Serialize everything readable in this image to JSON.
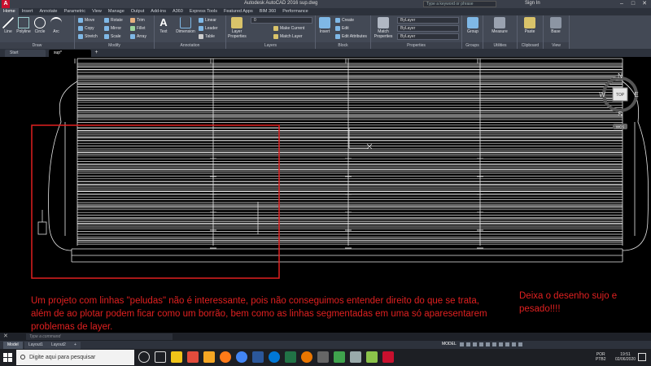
{
  "window": {
    "title": "Autodesk AutoCAD 2016    sup.dwg",
    "search_placeholder": "Type a keyword or phrase",
    "signin": "Sign In",
    "controls": [
      "–",
      "□",
      "✕"
    ]
  },
  "ribbon_tabs": [
    "Home",
    "Insert",
    "Annotate",
    "Parametric",
    "View",
    "Manage",
    "Output",
    "Add-ins",
    "A360",
    "Express Tools",
    "Featured Apps",
    "BIM 360",
    "Performance"
  ],
  "ribbon": {
    "draw": {
      "title": "Draw",
      "line": "Line",
      "polyline": "Polyline",
      "circle": "Circle",
      "arc": "Arc"
    },
    "modify": {
      "title": "Modify",
      "move": "Move",
      "rotate": "Rotate",
      "trim": "Trim",
      "copy": "Copy",
      "mirror": "Mirror",
      "fillet": "Fillet",
      "stretch": "Stretch",
      "scale": "Scale",
      "array": "Array"
    },
    "annotation": {
      "title": "Annotation",
      "text": "Text",
      "dimension": "Dimension",
      "linear": "Linear",
      "leader": "Leader",
      "table": "Table"
    },
    "layers": {
      "title": "Layers",
      "layer_properties": "Layer Properties",
      "current_layer": "0",
      "make_current": "Make Current",
      "match_layer": "Match Layer"
    },
    "block": {
      "title": "Block",
      "insert": "Insert",
      "create": "Create",
      "edit": "Edit",
      "edit_attributes": "Edit Attributes"
    },
    "properties": {
      "title": "Properties",
      "match_properties": "Match Properties",
      "bylayer1": "ByLayer",
      "bylayer2": "ByLayer",
      "bylayer3": "ByLayer"
    },
    "groups": {
      "title": "Groups",
      "group": "Group"
    },
    "utilities": {
      "title": "Utilities",
      "measure": "Measure"
    },
    "clipboard": {
      "title": "Clipboard",
      "paste": "Paste"
    },
    "view": {
      "title": "View",
      "base": "Base"
    }
  },
  "doc_tabs": [
    "Start",
    "sup*"
  ],
  "viewcube": {
    "n": "N",
    "s": "S",
    "e": "E",
    "w": "W",
    "top": "TOP",
    "wcs": "WCS"
  },
  "annotations": {
    "main": "Um projeto com linhas \"peludas\" não é interessante,  pois não conseguimos entender direito do que se trata, além de ao plotar podem ficar como um borrão, bem como as linhas segmentadas em uma só aparesentarem problemas de layer.",
    "side": "Deixa o desenho sujo e pesado!!!!"
  },
  "command": {
    "placeholder": "Type a command"
  },
  "layout_tabs": [
    "Model",
    "Layout1",
    "Layout2",
    "+"
  ],
  "status": {
    "model": "MODEL"
  },
  "taskbar": {
    "search_placeholder": "Digite aqui para pesquisar",
    "lang_line1": "POR",
    "lang_line2": "PTB2",
    "time": "19:51",
    "date": "02/06/2020"
  },
  "colors": {
    "accent_red": "#e02020",
    "autocad_red": "#c8102e",
    "ribbon_bg": "#434955"
  }
}
